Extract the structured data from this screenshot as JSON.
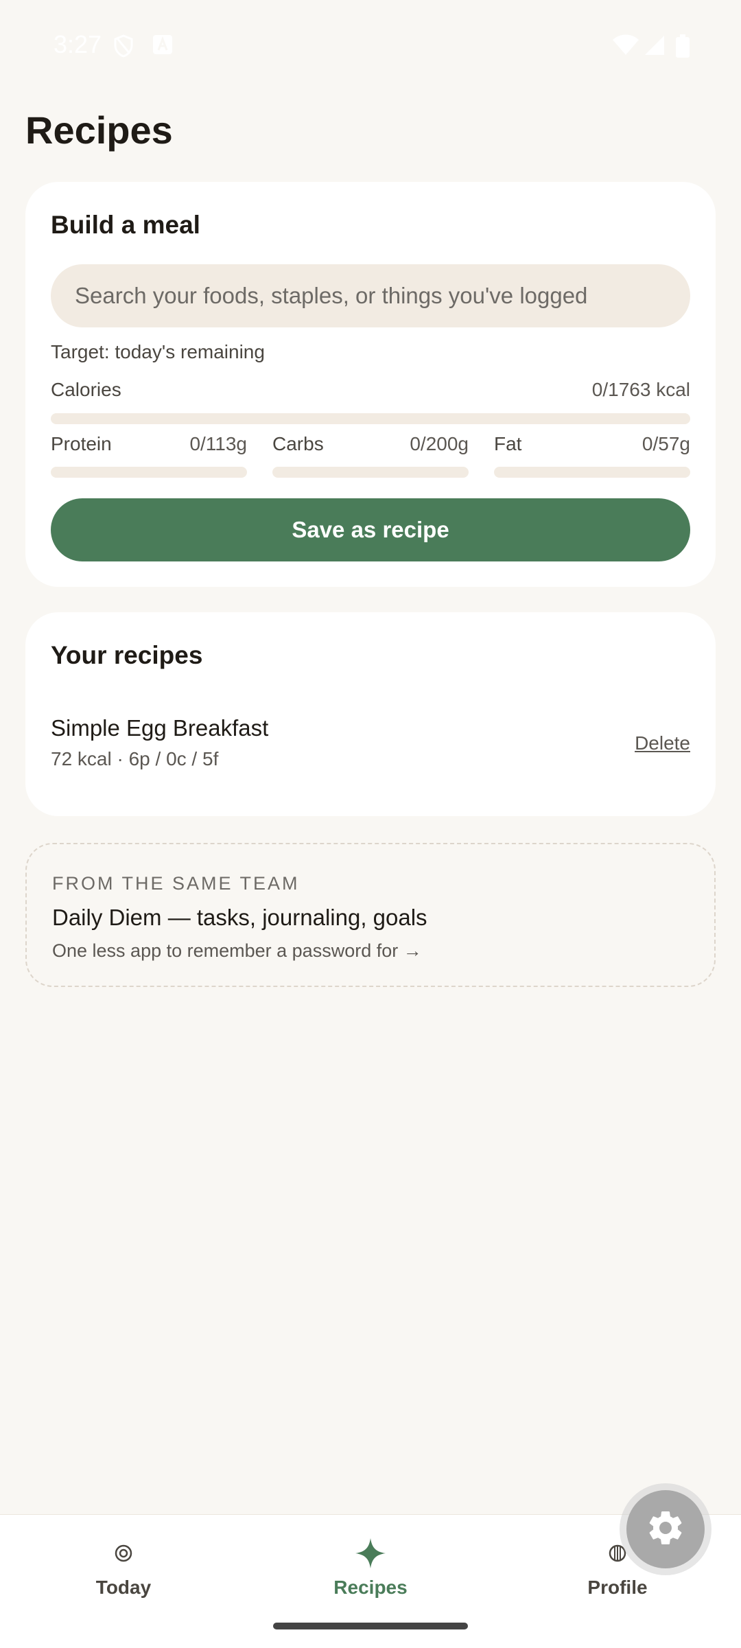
{
  "status_bar": {
    "time": "3:27",
    "icons": [
      "shield-icon",
      "a-icon",
      "wifi-icon",
      "signal-icon",
      "battery-icon"
    ]
  },
  "page": {
    "title": "Recipes"
  },
  "build_meal": {
    "title": "Build a meal",
    "search_placeholder": "Search your foods, staples, or things you've logged",
    "target_label": "Target: today's remaining",
    "calories": {
      "label": "Calories",
      "value": "0/1763 kcal",
      "progress": 0
    },
    "macros": [
      {
        "label": "Protein",
        "value": "0/113g",
        "progress": 0
      },
      {
        "label": "Carbs",
        "value": "0/200g",
        "progress": 0
      },
      {
        "label": "Fat",
        "value": "0/57g",
        "progress": 0
      }
    ],
    "save_label": "Save as recipe"
  },
  "recipes": {
    "title": "Your recipes",
    "items": [
      {
        "name": "Simple Egg Breakfast",
        "meta": "72 kcal · 6p / 0c / 5f",
        "delete_label": "Delete"
      }
    ]
  },
  "promo": {
    "eyebrow": "FROM THE SAME TEAM",
    "title": "Daily Diem — tasks, journaling, goals",
    "subtitle": "One less app to remember a password for →"
  },
  "nav": {
    "items": [
      {
        "label": "Today",
        "icon": "target-icon",
        "active": false
      },
      {
        "label": "Recipes",
        "icon": "sparkle-icon",
        "active": true
      },
      {
        "label": "Profile",
        "icon": "globe-icon",
        "active": false
      }
    ]
  },
  "fab": {
    "icon": "gear-icon"
  },
  "colors": {
    "background": "#f9f7f3",
    "card": "#ffffff",
    "accent": "#4a7c59",
    "input_fill": "#f2ebe2",
    "text_primary": "#1f1b16",
    "text_secondary": "#5b5752"
  }
}
